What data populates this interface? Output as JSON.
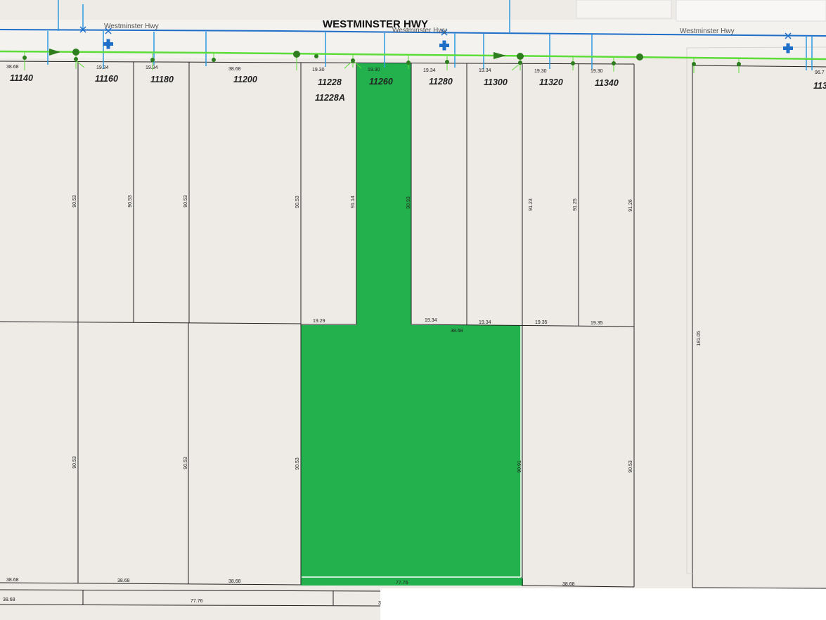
{
  "road": {
    "title": "WESTMINSTER HWY",
    "label_left": "Westminster Hwy",
    "label_mid": "Westminster Hwy",
    "label_right": "Westminster Hwy"
  },
  "addresses": {
    "a11140": "11140",
    "a11160": "11160",
    "a11180": "11180",
    "a11200": "11200",
    "a11228": "11228",
    "a11228A": "11228A",
    "a11260": "11260",
    "a11280": "11280",
    "a11300": "11300",
    "a11320": "11320",
    "a11340": "11340",
    "a113_partial": "113"
  },
  "dimensions": {
    "front": [
      "38.68",
      "19.34",
      "19.34",
      "38.68",
      "19.30",
      "19.30",
      "19.34",
      "19.34",
      "19.30",
      "19.30",
      "96.7"
    ],
    "mid": [
      "19.29",
      "19.34",
      "38.68",
      "19.34",
      "19.35",
      "19.35"
    ],
    "depth": [
      "90.53",
      "90.53",
      "90.53",
      "90.53",
      "91.14",
      "90.93",
      "91.23",
      "91.25",
      "91.26",
      "181.05",
      "90.53",
      "90.53",
      "90.53",
      "90.91",
      "90.53"
    ],
    "rear": [
      "38.68",
      "38.68",
      "38.68",
      "77.76",
      "38.68",
      "38.68",
      "77.76",
      "3"
    ]
  },
  "colors": {
    "background": "#eeebe7",
    "highlight_parcel": "#22b14c",
    "water_line": "#1f6fc9",
    "water_service": "#2d9be0",
    "sewer_line": "#5ddc3a",
    "sewer_node": "#2e7d1e"
  },
  "icons": {
    "hydrant": "blue-cross-hydrant-icon",
    "valve": "blue-x-valve-icon",
    "flow_arrow": "green-triangle-flow-icon",
    "manhole": "green-dot-manhole-icon"
  }
}
